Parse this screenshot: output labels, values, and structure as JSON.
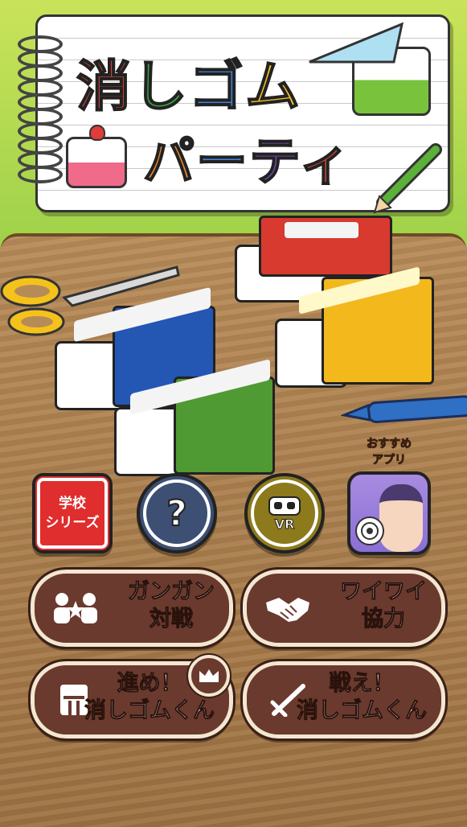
{
  "title": {
    "line1": [
      "消",
      "し",
      "ゴ",
      "ム"
    ],
    "line2": [
      "パ",
      "ー",
      "テ",
      "ィ"
    ]
  },
  "school_series": {
    "line1": "学校",
    "line2": "シリーズ"
  },
  "help_label": "?",
  "vr_label": "VR",
  "recommend": {
    "line1": "おすすめ",
    "line2": "アプリ"
  },
  "modes": {
    "versus": {
      "line1": "ガンガン",
      "line2": "対戦"
    },
    "coop": {
      "line1": "ワイワイ",
      "line2": "協力"
    },
    "advance": {
      "line1": "進め！",
      "line2": "消しゴムくん"
    },
    "fight": {
      "line1": "戦え！",
      "line2": "消しゴムくん"
    }
  },
  "colors": {
    "red": "#d83a2f",
    "blue": "#2456b4",
    "green": "#4f9a32",
    "yellow": "#f2b81c",
    "button": "#6a3a2e"
  }
}
